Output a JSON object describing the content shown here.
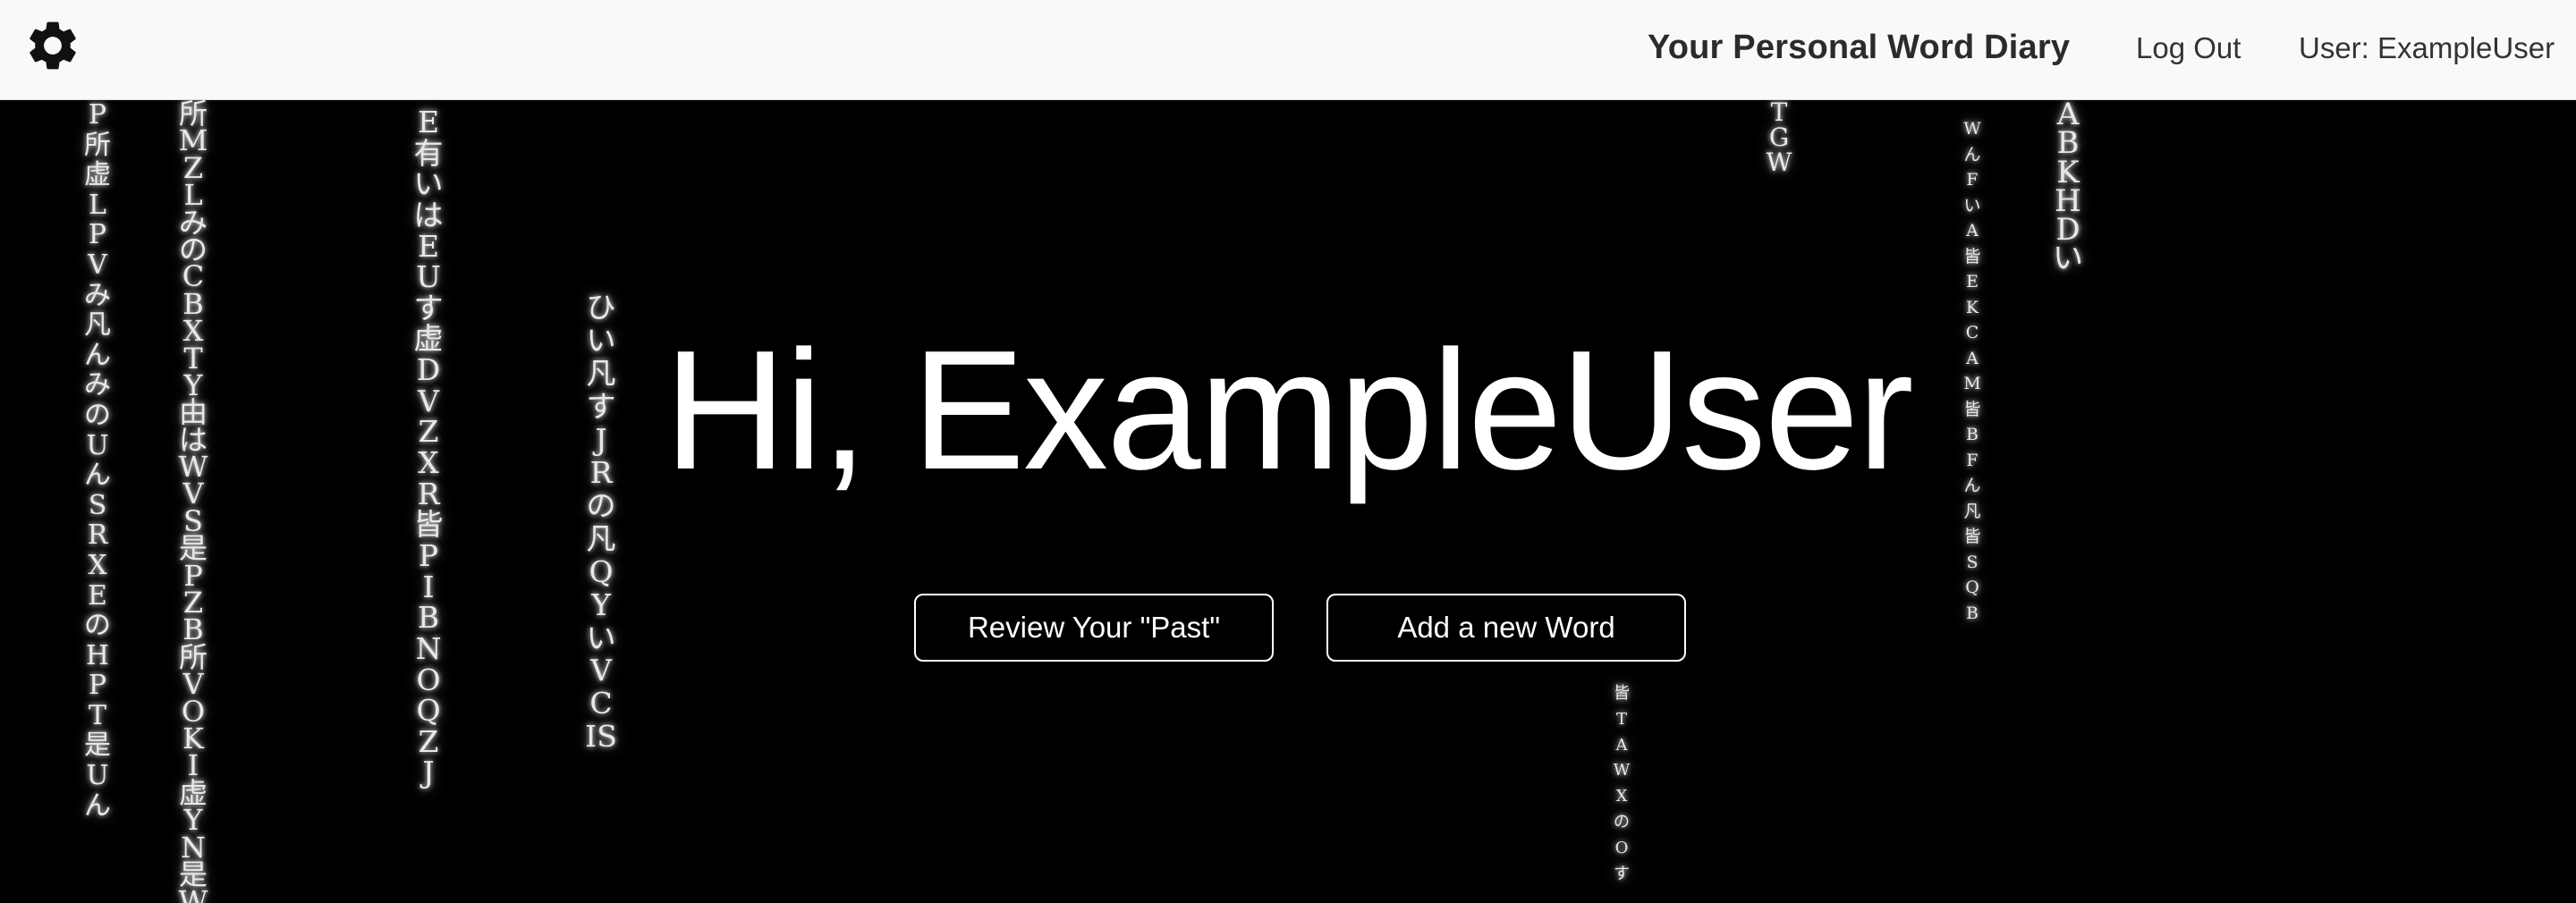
{
  "navbar": {
    "settings_icon": "gear-icon",
    "brand": "Your Personal Word Diary",
    "logout": "Log Out",
    "user_label": "User: ExampleUser"
  },
  "hero": {
    "greeting": "Hi, ExampleUser",
    "review_button": "Review Your \"Past\"",
    "add_button": "Add a new Word"
  },
  "background_rain": {
    "columns": [
      "P所虚LPV み凡んみ のUんS RX Eの HPT是Uん",
      "所MZLみのC BXTY由は WVS是PZB所 VOKI虚YN是W",
      "E有いはEUす虚DVZXR皆PIBNOQZJ",
      "ひい凡すJRの凡QYいVCIS",
      "TGW",
      "皆TA WXのO す",
      "WんFいA皆EKC AM皆BF ん凡皆SQB",
      "ABKHDい"
    ]
  },
  "colors": {
    "navbar_bg": "#f8f9fa",
    "page_bg": "#000000",
    "text_light": "#ffffff"
  }
}
